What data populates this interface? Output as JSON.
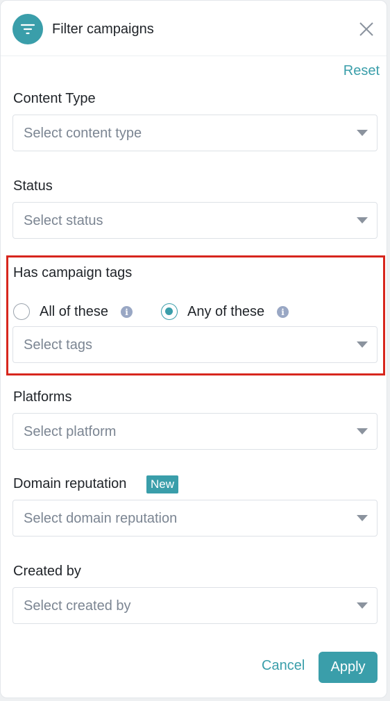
{
  "header": {
    "title": "Filter campaigns",
    "icon": "filter-icon",
    "close_icon": "close-icon"
  },
  "reset_label": "Reset",
  "fields": {
    "content_type": {
      "label": "Content Type",
      "placeholder": "Select content type"
    },
    "status": {
      "label": "Status",
      "placeholder": "Select status"
    },
    "campaign_tags": {
      "label": "Has campaign tags",
      "options": [
        {
          "label": "All of these",
          "selected": false
        },
        {
          "label": "Any of these",
          "selected": true
        }
      ],
      "placeholder": "Select tags"
    },
    "platforms": {
      "label": "Platforms",
      "placeholder": "Select platform"
    },
    "domain_reputation": {
      "label": "Domain reputation",
      "badge": "New",
      "placeholder": "Select domain reputation"
    },
    "created_by": {
      "label": "Created by",
      "placeholder": "Select created by"
    }
  },
  "footer": {
    "cancel_label": "Cancel",
    "apply_label": "Apply"
  },
  "colors": {
    "accent": "#3a9eaa",
    "highlight_border": "#d7261d",
    "info_icon": "#99a7c4"
  }
}
